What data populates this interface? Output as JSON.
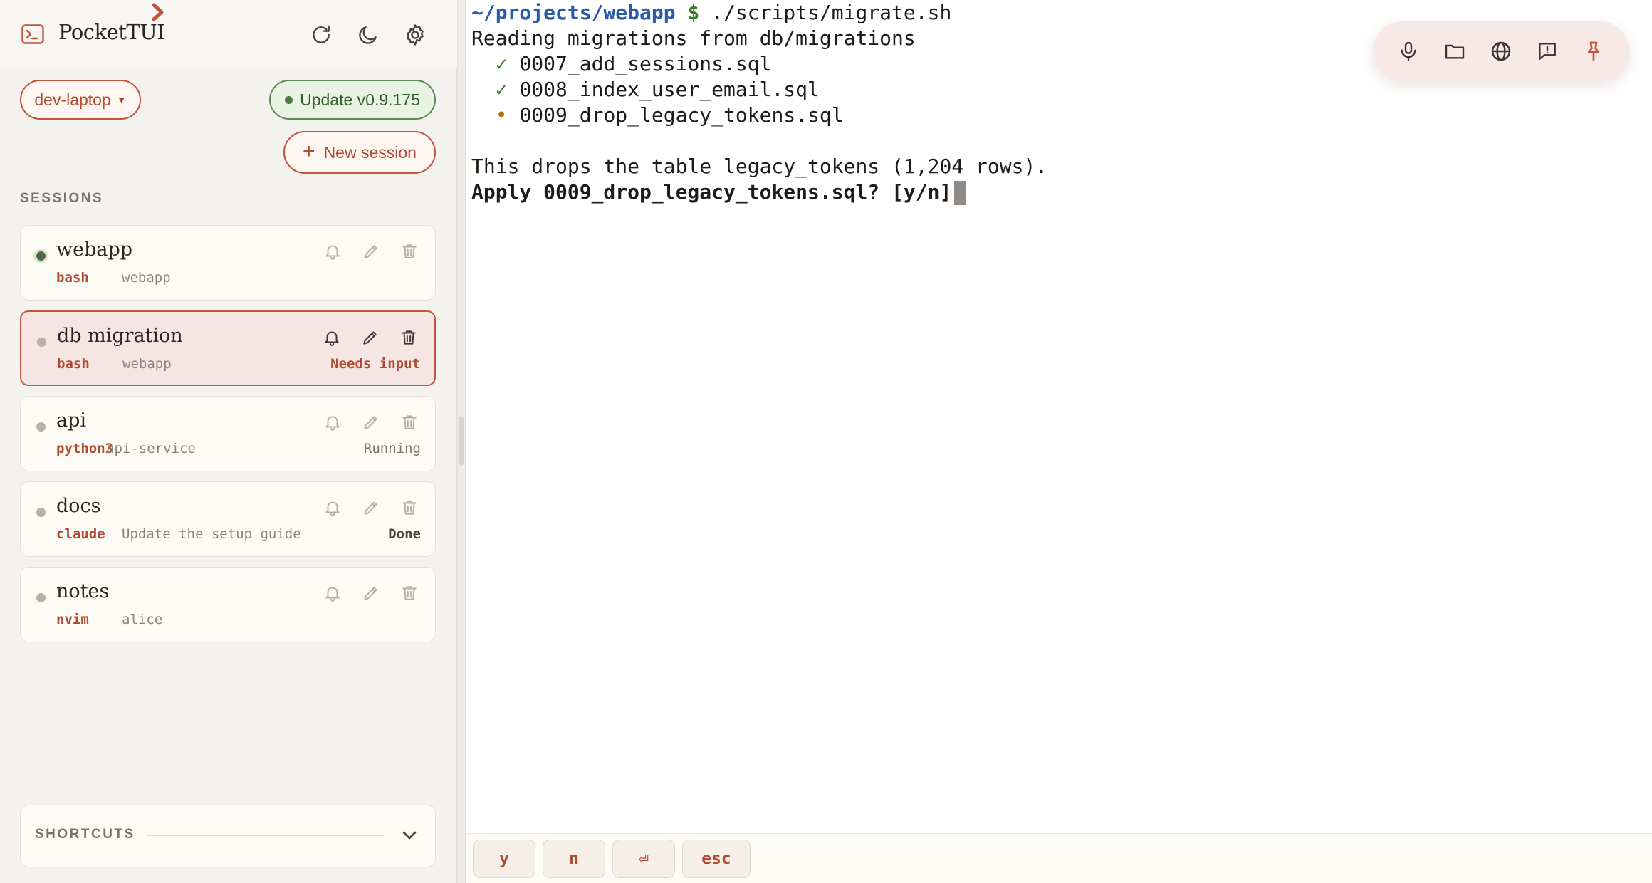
{
  "app": {
    "name": "PocketTUI"
  },
  "header": {
    "host_label": "dev-laptop",
    "update_label": "Update v0.9.175",
    "new_session_label": "New session"
  },
  "sessions_title": "SESSIONS",
  "sessions": [
    {
      "name": "webapp",
      "command": "bash",
      "detail": "webapp",
      "state": ""
    },
    {
      "name": "db migration",
      "command": "bash",
      "detail": "webapp",
      "state": "Needs input"
    },
    {
      "name": "api",
      "command": "python3",
      "detail": "api-service",
      "state": "Running"
    },
    {
      "name": "docs",
      "command": "claude",
      "detail": "Update the setup guide",
      "state": "Done"
    },
    {
      "name": "notes",
      "command": "nvim",
      "detail": "alice",
      "state": ""
    }
  ],
  "shortcuts_title": "SHORTCUTS",
  "terminal": {
    "prompt_path": "~/projects/webapp",
    "prompt_symbol": "$",
    "command": " ./scripts/migrate.sh",
    "line_reading": "Reading migrations from db/migrations",
    "migrations": [
      {
        "mark": "✓",
        "file": "0007_add_sessions.sql"
      },
      {
        "mark": "✓",
        "file": "0008_index_user_email.sql"
      },
      {
        "mark": "•",
        "file": "0009_drop_legacy_tokens.sql"
      }
    ],
    "warning": "This drops the table legacy_tokens (1,204 rows).",
    "question": "Apply 0009_drop_legacy_tokens.sql? [y/n]"
  },
  "keys": {
    "k1": "y",
    "k2": "n",
    "k3": "⏎",
    "k4": "esc"
  },
  "icons": {
    "brand": "terminal-icon",
    "refresh": "refresh-icon",
    "theme": "moon-icon",
    "settings": "gear-icon",
    "toolbar": [
      "microphone-icon",
      "folder-icon",
      "globe-icon",
      "feedback-icon",
      "pin-icon"
    ]
  },
  "colors": {
    "accent": "#c0533a",
    "update_green": "#4e7a45",
    "prompt_blue": "#2a5aa8"
  }
}
